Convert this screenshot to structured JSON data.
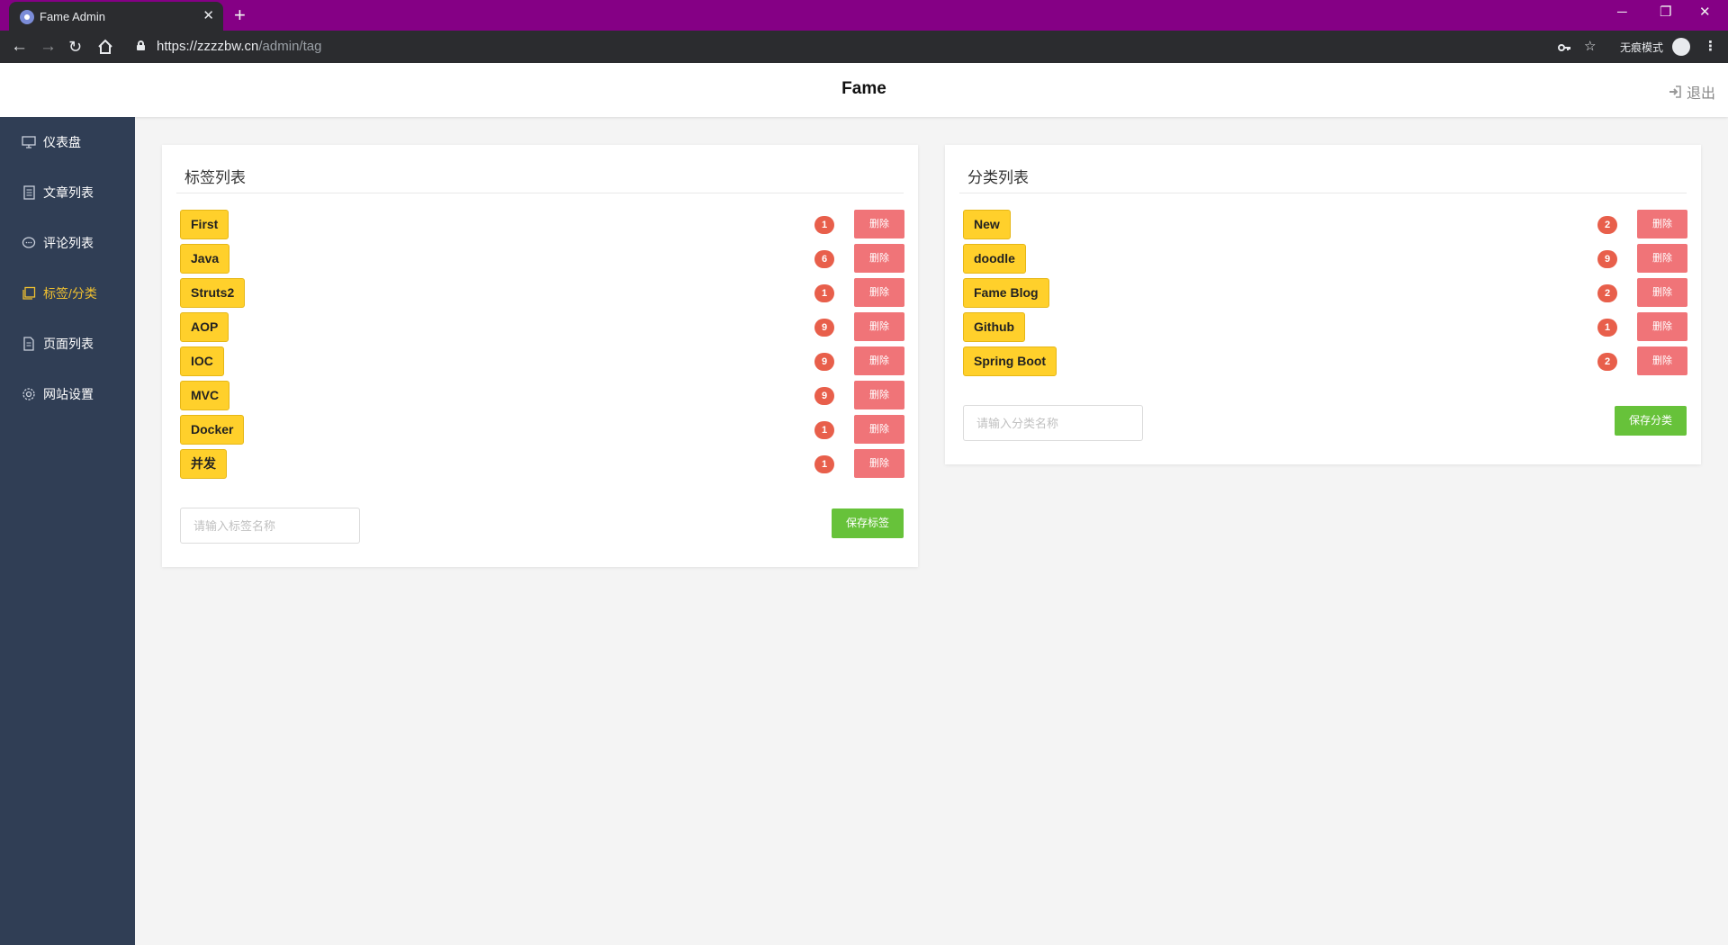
{
  "browser": {
    "tab_title": "Fame Admin",
    "tab_close": "✕",
    "new_tab": "+",
    "url_host": "https://zzzzbw.cn",
    "url_path": "/admin/tag",
    "incognito_label": "无痕模式",
    "window_controls": {
      "minimize": "─",
      "restore": "❐",
      "close": "✕"
    }
  },
  "header": {
    "title": "Fame",
    "logout_label": "退出"
  },
  "sidebar": {
    "items": [
      {
        "label": "仪表盘",
        "icon": "monitor-icon",
        "active": false
      },
      {
        "label": "文章列表",
        "icon": "document-list-icon",
        "active": false
      },
      {
        "label": "评论列表",
        "icon": "comment-icon",
        "active": false
      },
      {
        "label": "标签/分类",
        "icon": "tags-icon",
        "active": true
      },
      {
        "label": "页面列表",
        "icon": "page-icon",
        "active": false
      },
      {
        "label": "网站设置",
        "icon": "gear-icon",
        "active": false
      }
    ],
    "active_color": "#f0c030"
  },
  "tags_panel": {
    "title": "标签列表",
    "items": [
      {
        "name": "First",
        "count": "1",
        "delete_label": "删除"
      },
      {
        "name": "Java",
        "count": "6",
        "delete_label": "删除"
      },
      {
        "name": "Struts2",
        "count": "1",
        "delete_label": "删除"
      },
      {
        "name": "AOP",
        "count": "9",
        "delete_label": "删除"
      },
      {
        "name": "IOC",
        "count": "9",
        "delete_label": "删除"
      },
      {
        "name": "MVC",
        "count": "9",
        "delete_label": "删除"
      },
      {
        "name": "Docker",
        "count": "1",
        "delete_label": "删除"
      },
      {
        "name": "并发",
        "count": "1",
        "delete_label": "删除"
      }
    ],
    "input_placeholder": "请输入标签名称",
    "save_label": "保存标签"
  },
  "categories_panel": {
    "title": "分类列表",
    "items": [
      {
        "name": "New",
        "count": "2",
        "delete_label": "删除"
      },
      {
        "name": "doodle",
        "count": "9",
        "delete_label": "删除"
      },
      {
        "name": "Fame Blog",
        "count": "2",
        "delete_label": "删除"
      },
      {
        "name": "Github",
        "count": "1",
        "delete_label": "删除"
      },
      {
        "name": "Spring Boot",
        "count": "2",
        "delete_label": "删除"
      }
    ],
    "input_placeholder": "请输入分类名称",
    "save_label": "保存分类"
  },
  "colors": {
    "chrome_tabbar": "#850085",
    "sidebar_bg": "#303e55",
    "tag_yellow": "#ffd02b",
    "badge_red": "#e85f4b",
    "delete_pink": "#f07478",
    "save_green": "#67c23a"
  }
}
